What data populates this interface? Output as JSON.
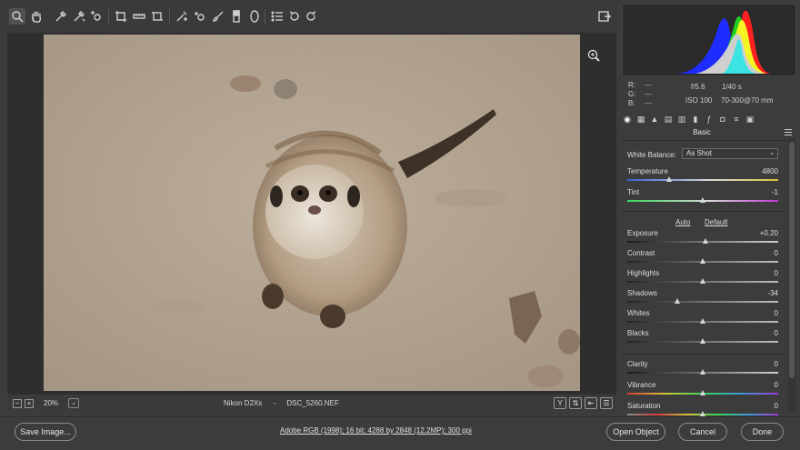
{
  "toolbar": {
    "tools": [
      "zoom-icon",
      "hand-icon",
      "white-balance-icon",
      "color-sampler-icon",
      "targeted-adjustment-icon",
      "crop-icon",
      "straighten-icon",
      "transform-icon",
      "spot-removal-icon",
      "red-eye-icon",
      "adjustment-brush-icon",
      "graduated-filter-icon",
      "radial-filter-icon",
      "preferences-icon",
      "rotate-left-icon",
      "rotate-right-icon"
    ],
    "fullscreen_icon": "toggle-fullscreen-icon"
  },
  "statusbar": {
    "zoom": "20%",
    "camera": "Nikon D2Xs",
    "separator": "-",
    "filename": "DSC_5260.NEF"
  },
  "readout": {
    "r_label": "R:",
    "r_value": "---",
    "g_label": "G:",
    "g_value": "---",
    "b_label": "B:",
    "b_value": "---",
    "aperture": "f/5.6",
    "shutter": "1/40 s",
    "iso": "ISO 100",
    "lens": "70-300@70 mm"
  },
  "panel": {
    "title": "Basic",
    "white_balance_label": "White Balance:",
    "white_balance_value": "As Shot",
    "auto": "Auto",
    "default": "Default",
    "sliders": [
      {
        "label": "Temperature",
        "value": "4800",
        "pos": 0.28
      },
      {
        "label": "Tint",
        "value": "-1",
        "pos": 0.5
      },
      {
        "label": "Exposure",
        "value": "+0.20",
        "pos": 0.52
      },
      {
        "label": "Contrast",
        "value": "0",
        "pos": 0.5
      },
      {
        "label": "Highlights",
        "value": "0",
        "pos": 0.5
      },
      {
        "label": "Shadows",
        "value": "-34",
        "pos": 0.33
      },
      {
        "label": "Whites",
        "value": "0",
        "pos": 0.5
      },
      {
        "label": "Blacks",
        "value": "0",
        "pos": 0.5
      },
      {
        "label": "Clarity",
        "value": "0",
        "pos": 0.5
      },
      {
        "label": "Vibrance",
        "value": "0",
        "pos": 0.5
      },
      {
        "label": "Saturation",
        "value": "0",
        "pos": 0.5
      }
    ]
  },
  "bottom": {
    "save": "Save Image...",
    "workflow": "Adobe RGB (1998); 16 bit; 4288 by 2848 (12.2MP); 300 ppi",
    "open": "Open Object",
    "cancel": "Cancel",
    "done": "Done"
  }
}
